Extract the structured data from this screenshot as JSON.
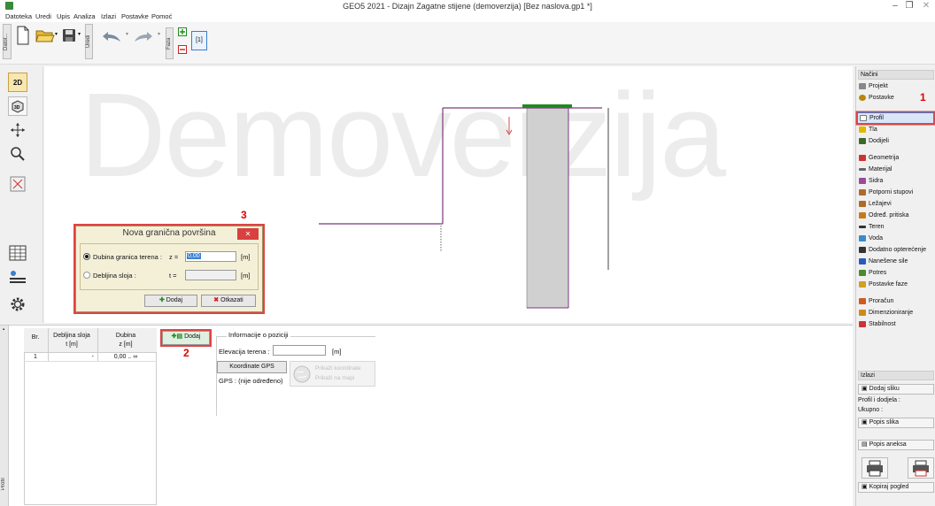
{
  "window": {
    "title": "GEO5 2021 - Dizajn Zagatne stijene (demoverzija) [Bez naslova.gp1 *]",
    "min": "–",
    "max": "❐",
    "close": "✕"
  },
  "menu": [
    "Datoteka",
    "Uredi",
    "Upis",
    "Analiza",
    "Izlazi",
    "Postavke",
    "Pomoć"
  ],
  "toolbar": {
    "file_tab": "Datot...",
    "edit_tab": "Uredi",
    "phase_tab": "Faza",
    "phase_label": "[1]"
  },
  "watermark": "Demoverzija",
  "left_tools": {
    "view_2d": "2D",
    "view_3d": "3D"
  },
  "right_panel": {
    "header_modes": "Načini",
    "items_top": [
      "Projekt",
      "Postavke",
      "Profil",
      "Tla",
      "Dodijeli"
    ],
    "items_mid": [
      "Geometrija",
      "Materijal",
      "Sidra",
      "Potporni stupovi",
      "Ležajevi",
      "Određ. pritiska",
      "Teren",
      "Voda",
      "Dodatno opterećenje",
      "Nanešene sile",
      "Potres",
      "Postavke faze"
    ],
    "items_bottom": [
      "Proračun",
      "Dimenzioniranje",
      "Stabilnost"
    ],
    "header_outputs": "Izlazi",
    "add_image": "Dodaj sliku",
    "profile_assign": "Profil i dodjela :",
    "total": "Ukupno :",
    "image_list": "Popis slika",
    "annex_list": "Popis aneksa",
    "copy_view": "Kopiraj pogled"
  },
  "annotations": {
    "a1": "1",
    "a2": "2",
    "a3": "3"
  },
  "dialog": {
    "title": "Nova granična površina",
    "opt1_label": "Dubina granica terena :",
    "opt1_var": "z =",
    "opt1_value": "0,00",
    "opt1_unit": "[m]",
    "opt2_label": "Debljina sloja :",
    "opt2_var": "t =",
    "opt2_unit": "[m]",
    "add": "Dodaj",
    "cancel": "Otkazati"
  },
  "table": {
    "headers": [
      "Br.",
      "Debljina sloja",
      "Dubina"
    ],
    "units": [
      "",
      "t [m]",
      "z [m]"
    ],
    "rows": [
      [
        "1",
        "-",
        "0,00 .. ∞"
      ]
    ],
    "add_button": "Dodaj"
  },
  "position_info": {
    "title": "Informacije o poziciji",
    "elevation_label": "Elevacija terena :",
    "elevation_unit": "[m]",
    "gps_button": "Koordinate GPS",
    "gps_status": "GPS : (nije određeno)",
    "show_coords": "Prikaži koordinate",
    "show_map": "Prikaži na mapi"
  },
  "bottom_tab": "Profil",
  "colors": {
    "accent_red": "#e00000",
    "green": "#1f8a1f",
    "wall_fill": "#d0d0d0"
  }
}
